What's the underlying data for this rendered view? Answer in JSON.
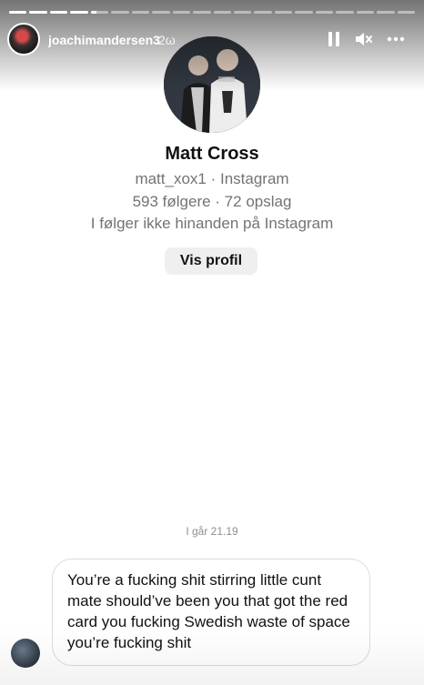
{
  "story": {
    "segment_count": 20,
    "segments_seen": 4,
    "current_segment_progress": 0.3,
    "username": "joachimandersen3",
    "time_ago": "2ω",
    "controls": {
      "pause_icon": "pause-icon",
      "mute_icon": "speaker-muted-icon",
      "more_icon": "more-horizontal-icon"
    }
  },
  "profile": {
    "name": "Matt Cross",
    "handle_line": "matt_xox1 · Instagram",
    "stats_line": "593 følgere · 72 opslag",
    "follow_line": "I følger ikke hinanden på Instagram",
    "view_profile_label": "Vis profil"
  },
  "chat": {
    "timestamp": "I går 21.19",
    "message": "You’re a fucking shit stirring little cunt mate should’ve been you that got the red card you fucking Swedish waste of space you’re fucking shit"
  },
  "colors": {
    "secondary_text": "#737373",
    "button_bg": "#efefef",
    "bubble_border": "#dbdbdb"
  }
}
